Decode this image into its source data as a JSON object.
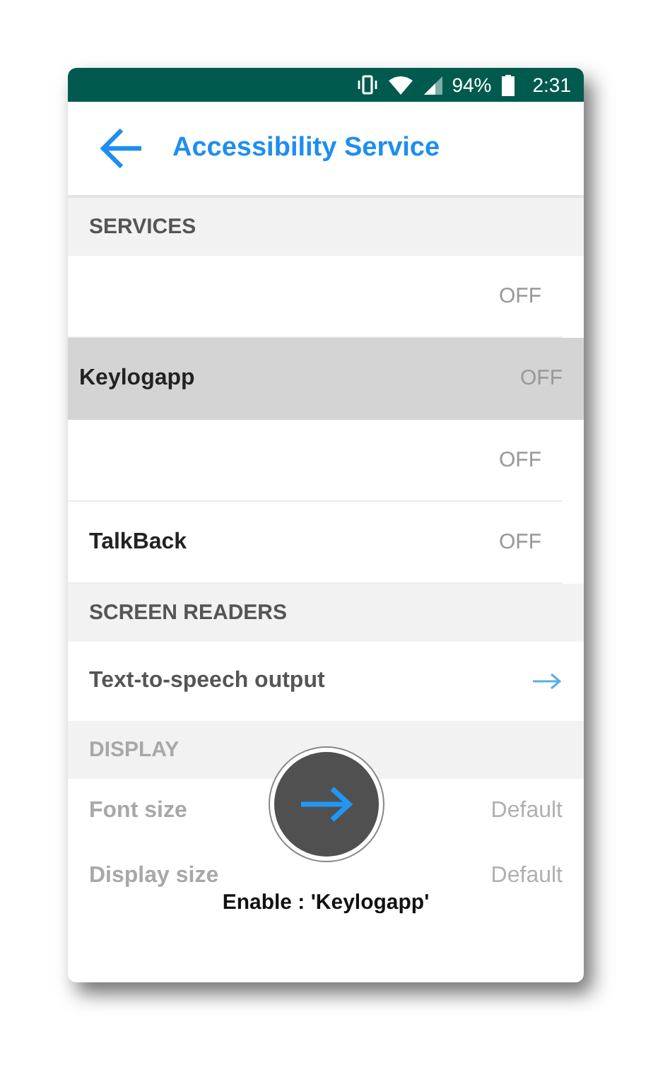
{
  "status_bar": {
    "battery": "94%",
    "time": "2:31"
  },
  "header": {
    "title": "Accessibility Service"
  },
  "rows": [
    {
      "kind": "section",
      "label": "SERVICES",
      "dimmed": false
    },
    {
      "kind": "toggle",
      "label": "",
      "value": "OFF",
      "selected": false,
      "dimmed": false
    },
    {
      "kind": "toggle",
      "label": "Keylogapp",
      "value": "OFF",
      "selected": true,
      "dimmed": false
    },
    {
      "kind": "toggle",
      "label": "",
      "value": "OFF",
      "selected": false,
      "dimmed": false
    },
    {
      "kind": "toggle",
      "label": "TalkBack",
      "value": "OFF",
      "selected": false,
      "dimmed": false
    },
    {
      "kind": "section",
      "label": "SCREEN READERS",
      "dimmed": false
    },
    {
      "kind": "link",
      "label": "Text-to-speech output",
      "dimmed": false
    },
    {
      "kind": "section",
      "label": "DISPLAY",
      "dimmed": true
    },
    {
      "kind": "value",
      "label": "Font size",
      "value": "Default",
      "dimmed": true
    },
    {
      "kind": "value",
      "label": "Display size",
      "value": "Default",
      "dimmed": true
    }
  ],
  "overlay": {
    "caption": "Enable : 'Keylogapp'"
  }
}
